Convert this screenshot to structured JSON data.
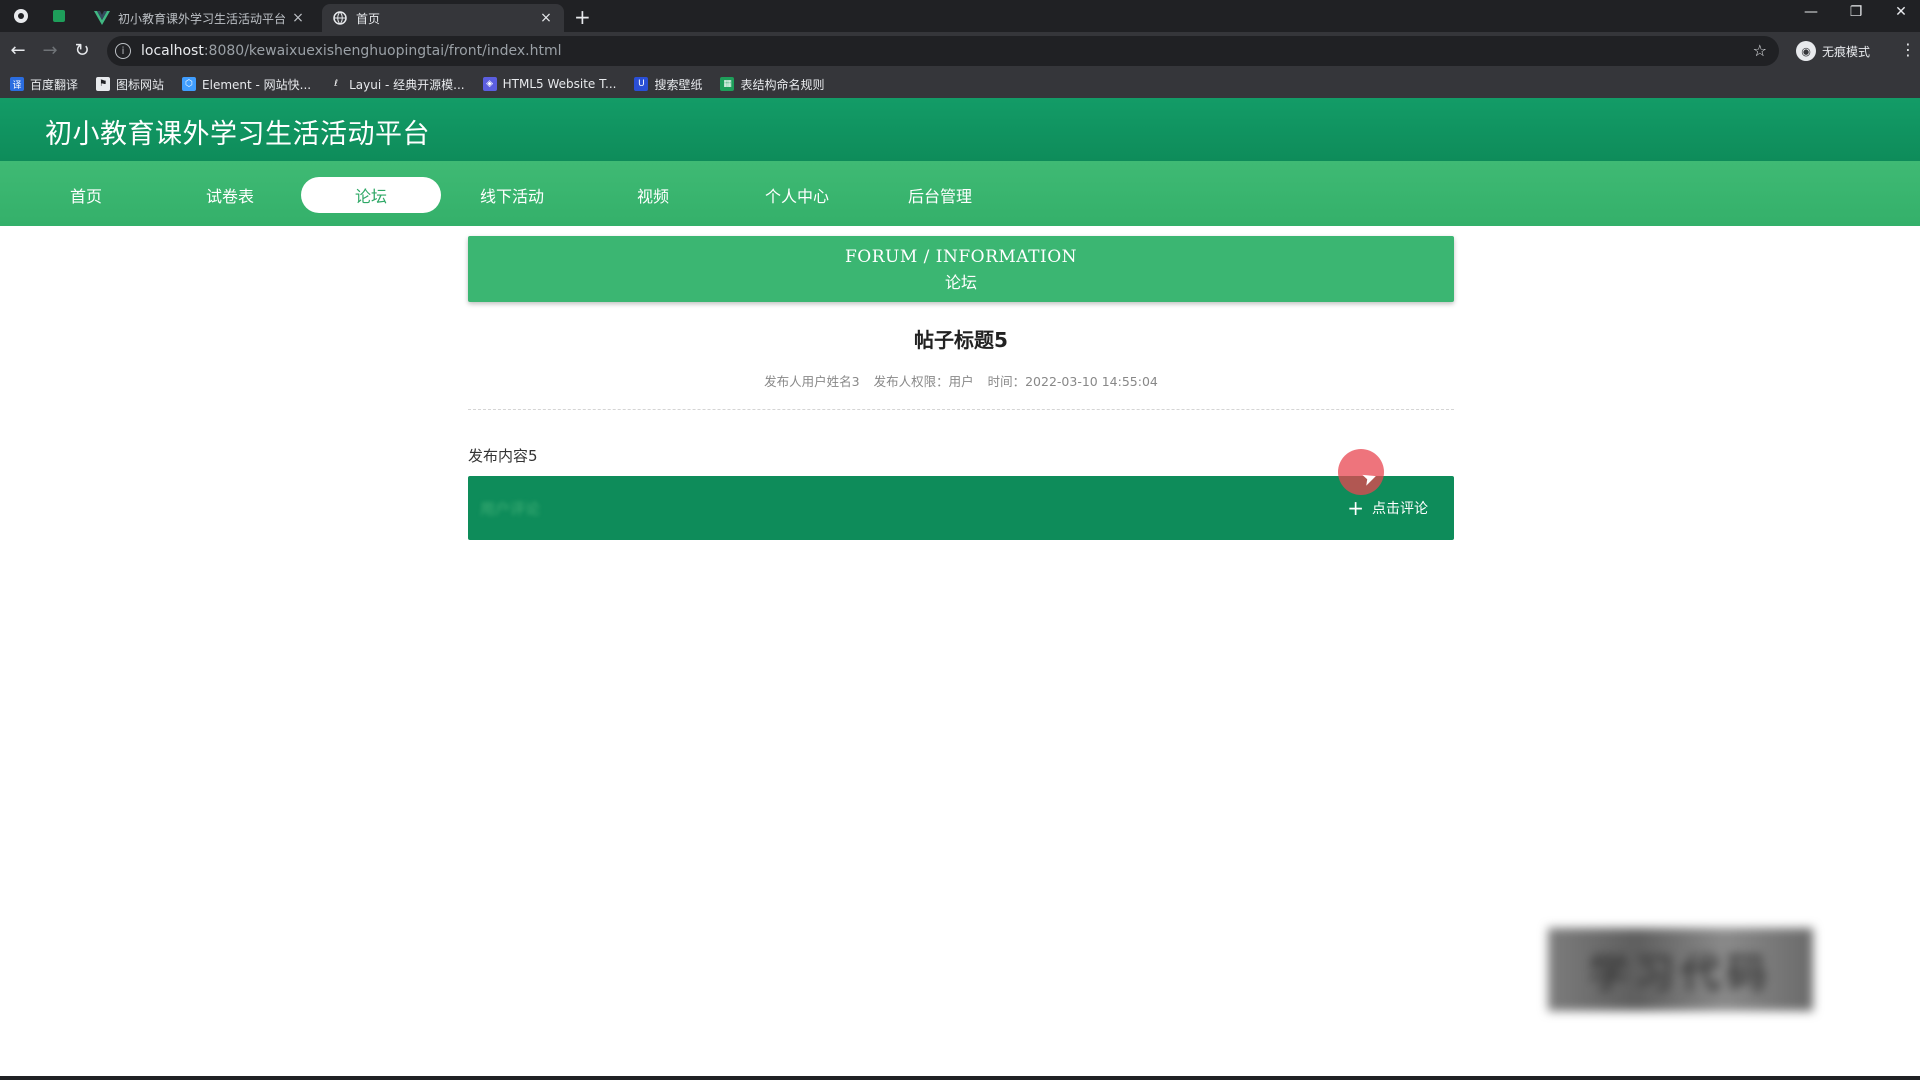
{
  "browser": {
    "tabs": [
      {
        "title": "初小教育课外学习生活活动平台",
        "active": false
      },
      {
        "title": "首页",
        "active": true
      }
    ],
    "url_host": "localhost",
    "url_path": ":8080/kewaixuexishenghuopingtai/front/index.html",
    "profile_label": "无痕模式",
    "bookmarks": [
      "百度翻译",
      "图标网站",
      "Element - 网站快...",
      "Layui - 经典开源模...",
      "HTML5 Website T...",
      "搜索壁纸",
      "表结构命名规则"
    ]
  },
  "site": {
    "title": "初小教育课外学习生活活动平台",
    "nav": [
      "首页",
      "试卷表",
      "论坛",
      "线下活动",
      "视频",
      "个人中心",
      "后台管理"
    ],
    "active_nav": "论坛"
  },
  "banner": {
    "en": "FORUM / INFORMATION",
    "cn": "论坛"
  },
  "post": {
    "title": "帖子标题5",
    "author": "发布人用户姓名3",
    "role": "发布人权限：用户",
    "time": "时间：2022-03-10 14:55:04",
    "content": "发布内容5"
  },
  "comment": {
    "header_blurred": "用户评论",
    "button_label": "点击评论"
  },
  "watermark_text": "学习代码",
  "colors": {
    "header_green": "#0e8c5a",
    "nav_green": "#3bb672",
    "tab_bg": "#202124",
    "toolbar_bg": "#35363a"
  }
}
